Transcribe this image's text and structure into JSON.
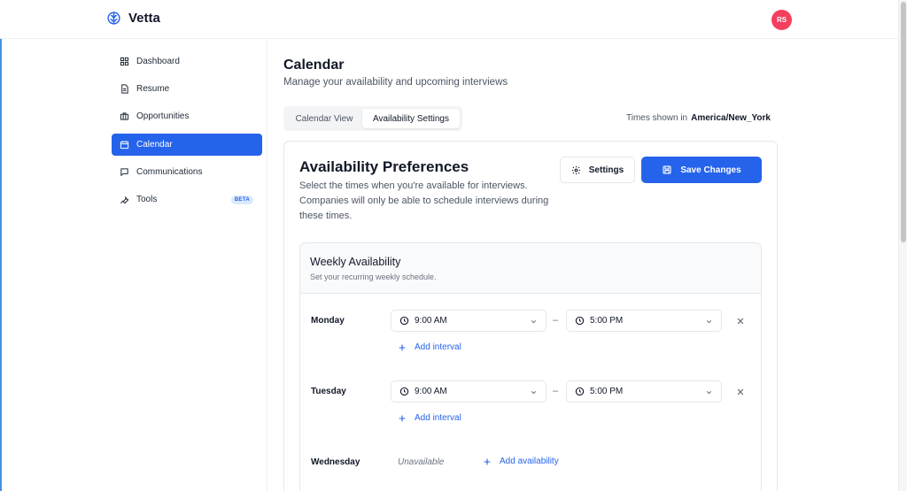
{
  "app": {
    "brand": "Vetta",
    "avatar_initials": "RS",
    "avatar_color": "#f43f5e",
    "accent": "#2563eb"
  },
  "sidebar": {
    "items": [
      {
        "label": "Dashboard",
        "icon": "grid-icon"
      },
      {
        "label": "Resume",
        "icon": "document-icon"
      },
      {
        "label": "Opportunities",
        "icon": "briefcase-icon"
      },
      {
        "label": "Calendar",
        "icon": "calendar-icon",
        "active": true
      },
      {
        "label": "Communications",
        "icon": "chat-icon"
      },
      {
        "label": "Tools",
        "icon": "wrench-icon",
        "badge": "BETA"
      }
    ]
  },
  "page": {
    "title": "Calendar",
    "subtitle": "Manage your availability and upcoming interviews",
    "tabs": [
      {
        "label": "Calendar View"
      },
      {
        "label": "Availability Settings",
        "active": true
      }
    ],
    "timezone_label": "Times shown in",
    "timezone_value": "America/New_York"
  },
  "availability": {
    "title": "Availability Preferences",
    "description": "Select the times when you're available for interviews. Companies will only be able to schedule interviews during these times.",
    "settings_label": "Settings",
    "save_label": "Save Changes",
    "weekly": {
      "title": "Weekly Availability",
      "subtitle": "Set your recurring weekly schedule.",
      "days": [
        {
          "day": "Monday",
          "start": "9:00 AM",
          "end": "5:00 PM",
          "add_label": "Add interval"
        },
        {
          "day": "Tuesday",
          "start": "9:00 AM",
          "end": "5:00 PM",
          "add_label": "Add interval"
        },
        {
          "day": "Wednesday",
          "status": "Unavailable",
          "add_label": "Add availability"
        }
      ],
      "separator": "–"
    }
  }
}
